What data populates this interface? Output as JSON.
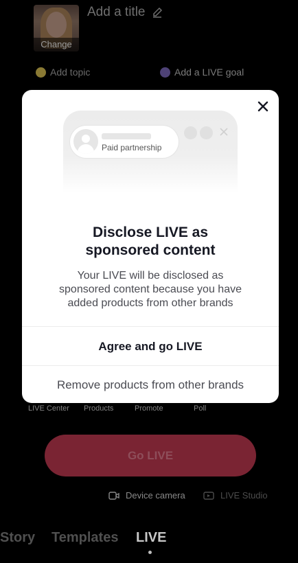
{
  "setup": {
    "thumbnail_change_label": "Change",
    "title_placeholder": "Add a title",
    "add_topic_label": "Add topic",
    "add_goal_label": "Add a LIVE goal"
  },
  "tools": [
    "LIVE Center",
    "Products",
    "Promote",
    "Poll"
  ],
  "go_live_label": "Go LIVE",
  "camera": {
    "device_camera_label": "Device camera",
    "live_studio_label": "LIVE Studio"
  },
  "tabs": [
    {
      "label": "Story",
      "active": false
    },
    {
      "label": "Templates",
      "active": false
    },
    {
      "label": "LIVE",
      "active": true
    }
  ],
  "modal": {
    "preview_label": "Paid partnership",
    "heading_line1": "Disclose LIVE as",
    "heading_line2": "sponsored content",
    "body_line1": "Your LIVE will be disclosed as",
    "body_line2": "sponsored content because you have",
    "body_line3": "added products from other brands",
    "agree_label": "Agree and go LIVE",
    "remove_label": "Remove products from other brands"
  },
  "colors": {
    "go_live_bg": "#7a2433",
    "modal_bg": "#ffffff",
    "overlay": "#000000"
  },
  "icons": {
    "close": "close-icon",
    "pencil": "pencil-icon",
    "topic": "topic-icon",
    "goal": "goal-icon",
    "camera": "camera-icon",
    "studio": "studio-icon"
  }
}
